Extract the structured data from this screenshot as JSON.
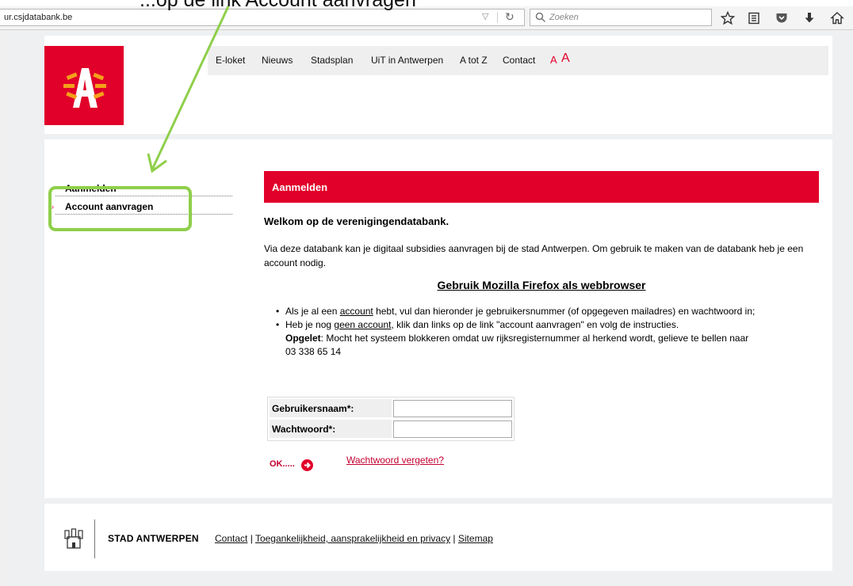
{
  "annotation": {
    "caption": "...op de link Account aanvragen"
  },
  "browser": {
    "url": "ur.csjdatabank.be",
    "search_placeholder": "Zoeken"
  },
  "nav": {
    "items": [
      "E-loket",
      "Nieuws",
      "Stadsplan",
      "UiT in Antwerpen",
      "A tot Z",
      "Contact"
    ],
    "font_small": "A",
    "font_large": "A"
  },
  "sidebar": {
    "items": [
      {
        "label": "Aanmelden"
      },
      {
        "label": "Account aanvragen"
      }
    ]
  },
  "main": {
    "panel_title": "Aanmelden",
    "welcome": "Welkom op de verenigingendatabank.",
    "intro": "Via deze databank kan je digitaal subsidies aanvragen bij de stad Antwerpen. Om gebruik te maken van de databank heb je een account nodig.",
    "firefox_notice": "Gebruik Mozilla Firefox als webbrowser",
    "bullet1": {
      "pre": "Als je al een ",
      "link": "account",
      "post": " hebt, vul dan hieronder je gebruikersnummer (of opgegeven mailadres) en wachtwoord in;"
    },
    "bullet2": {
      "pre": "Heb je nog ",
      "link": "geen account",
      "post": ", klik dan links op de link \"account aanvragen\" en volg de instructies."
    },
    "warning": {
      "label": "Opgelet",
      "text": ": Mocht het systeem blokkeren omdat uw rijksregisternummer al herkend wordt, gelieve te bellen naar",
      "phone": "03 338 65 14"
    }
  },
  "login": {
    "username_label": "Gebruikersnaam*:",
    "password_label": "Wachtwoord*:",
    "username_value": "",
    "password_value": "",
    "ok_label": "OK.....",
    "forgot_label": "Wachtwoord vergeten?"
  },
  "footer": {
    "brand": "STAD ANTWERPEN",
    "links": [
      "Contact",
      "Toegankelijkheid, aansprakelijkheid en privacy",
      "Sitemap"
    ]
  },
  "colors": {
    "brand_red": "#e1002a",
    "annotation_green": "#8fcf4a"
  }
}
